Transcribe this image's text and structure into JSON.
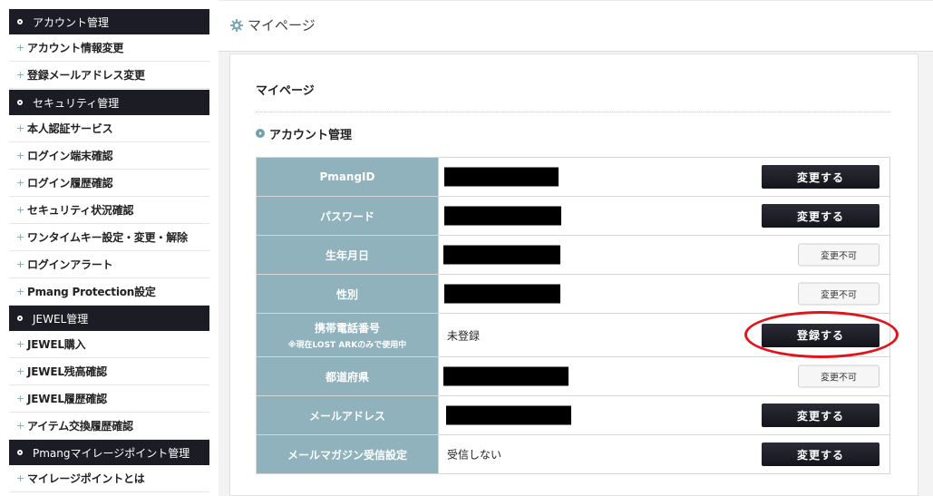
{
  "sidebar": {
    "sections": [
      {
        "title": "アカウント管理",
        "items": [
          "アカウント情報変更",
          "登録メールアドレス変更"
        ]
      },
      {
        "title": "セキュリティ管理",
        "items": [
          "本人認証サービス",
          "ログイン端末確認",
          "ログイン履歴確認",
          "セキュリティ状況確認",
          "ワンタイムキー設定・変更・解除",
          "ログインアラート",
          "Pmang Protection設定"
        ]
      },
      {
        "title": "JEWEL管理",
        "items": [
          "JEWEL購入",
          "JEWEL残高確認",
          "JEWEL履歴確認",
          "アイテム交換履歴確認"
        ]
      },
      {
        "title": "Pmangマイレージポイント管理",
        "items": [
          "マイレージポイントとは"
        ]
      }
    ]
  },
  "header": {
    "title": "マイページ"
  },
  "panel": {
    "title": "マイページ",
    "section_title": "アカウント管理",
    "rows": [
      {
        "label": "PmangID",
        "value": "",
        "redacted": true,
        "button": "変更する",
        "button_style": "dark"
      },
      {
        "label": "パスワード",
        "value": "",
        "redacted": true,
        "button": "変更する",
        "button_style": "dark"
      },
      {
        "label": "生年月日",
        "value": "",
        "redacted": true,
        "button": "変更不可",
        "button_style": "light"
      },
      {
        "label": "性別",
        "value": "",
        "redacted": true,
        "button": "変更不可",
        "button_style": "light"
      },
      {
        "label": "携帯電話番号",
        "sublabel": "※現在LOST ARKのみで使用中",
        "value": "未登録",
        "redacted": false,
        "button": "登録する",
        "button_style": "dark"
      },
      {
        "label": "都道府県",
        "value": "",
        "redacted": true,
        "button": "変更不可",
        "button_style": "light"
      },
      {
        "label": "メールアドレス",
        "value": "",
        "redacted": true,
        "button": "変更する",
        "button_style": "dark"
      },
      {
        "label": "メールマガジン受信設定",
        "value": "受信しない",
        "redacted": false,
        "button": "変更する",
        "button_style": "dark"
      }
    ]
  },
  "colors": {
    "sidebar_header": "#1b1c24",
    "label_bg": "#8fb2bd",
    "annotation": "#e0141b"
  }
}
